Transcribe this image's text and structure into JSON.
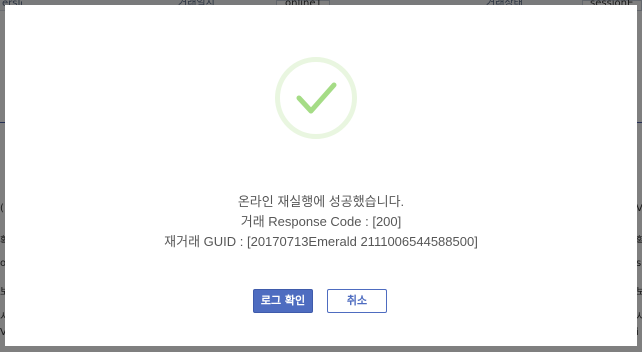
{
  "background": {
    "fields": [
      "ersId",
      "거래일시",
      "online1",
      "거래상태",
      "sessionE"
    ],
    "side_left": [
      "(",
      "확",
      "o",
      "보",
      "시",
      "V",
      "!",
      "h"
    ],
    "side_right": [
      "V",
      "확",
      "sk",
      "보",
      "시",
      "i",
      "!",
      "h"
    ]
  },
  "dialog": {
    "icon": "success-check-icon",
    "message": "온라인 재실행에 성공했습니다.",
    "response_code": "거래 Response Code : [200]",
    "guid": "재거래 GUID : [20170713Emerald 2111006544588500]",
    "confirm_label": "로그 확인",
    "cancel_label": "취소"
  },
  "colors": {
    "primary": "#4e6cc0",
    "success_check": "#a5dc86",
    "success_ring": "#e9f6e0",
    "text": "#575757"
  }
}
